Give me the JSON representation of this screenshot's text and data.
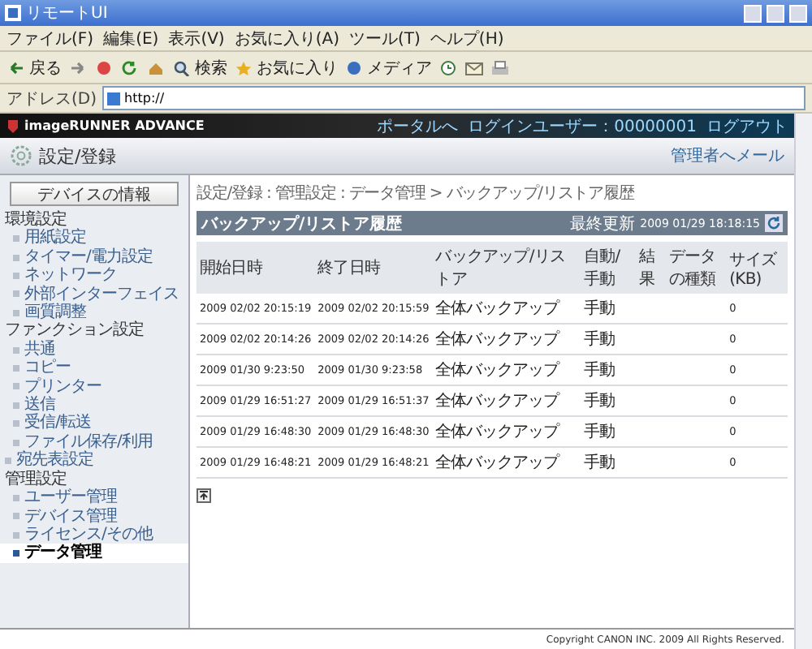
{
  "window": {
    "title": "リモートUI"
  },
  "menu_bar": [
    "ファイル(F)",
    "編集(E)",
    "表示(V)",
    "お気に入り(A)",
    "ツール(T)",
    "ヘルプ(H)"
  ],
  "toolbar": [
    {
      "label": "戻る",
      "kind": "back"
    },
    {
      "kind": "forward"
    },
    {
      "kind": "stop"
    },
    {
      "kind": "refresh"
    },
    {
      "kind": "home"
    },
    {
      "label": "検索",
      "kind": "search"
    },
    {
      "label": "お気に入り",
      "kind": "favorites"
    },
    {
      "label": "メディア",
      "kind": "media"
    },
    {
      "kind": "history"
    },
    {
      "kind": "mail"
    },
    {
      "kind": "print"
    }
  ],
  "address_bar": {
    "label": "アドレス(D)",
    "value": "http://"
  },
  "header": {
    "product": "imageRUNNER ADVANCE",
    "links": [
      "ポータルへ",
      "ログインユーザー：00000001",
      "ログアウト"
    ]
  },
  "section": {
    "title": "設定/登録",
    "mail_link": "管理者へメール"
  },
  "sidebar": {
    "button": "デバイスの情報",
    "tree": [
      {
        "label": "環境設定",
        "kind": "heading",
        "children": [
          {
            "label": "用紙設定",
            "selected": false
          },
          {
            "label": "タイマー/電力設定",
            "selected": false
          },
          {
            "label": "ネットワーク",
            "selected": false
          },
          {
            "label": "外部インターフェイス",
            "selected": false
          },
          {
            "label": "画質調整",
            "selected": false
          }
        ]
      },
      {
        "label": "ファンクション設定",
        "kind": "heading",
        "children": [
          {
            "label": "共通",
            "selected": false
          },
          {
            "label": "コピー",
            "selected": false
          },
          {
            "label": "プリンター",
            "selected": false
          },
          {
            "label": "送信",
            "selected": false
          },
          {
            "label": "受信/転送",
            "selected": false
          },
          {
            "label": "ファイル保存/利用",
            "selected": false
          }
        ]
      },
      {
        "label": "宛先表設定",
        "kind": "link",
        "selected": false
      },
      {
        "label": "管理設定",
        "kind": "heading",
        "children": [
          {
            "label": "ユーザー管理",
            "selected": false
          },
          {
            "label": "デバイス管理",
            "selected": false
          },
          {
            "label": "ライセンス/その他",
            "selected": false
          },
          {
            "label": "データ管理",
            "selected": true
          }
        ]
      }
    ]
  },
  "breadcrumb": "設定/登録 : 管理設定 : データ管理 > バックアップ/リストア履歴",
  "panel": {
    "title": "バックアップ/リストア履歴",
    "updated_label": "最終更新",
    "updated": "2009 01/29 18:18:15"
  },
  "table": {
    "columns": [
      "開始日時",
      "終了日時",
      "バックアップ/リストア",
      "自動/手動",
      "結果",
      "データの種類",
      "サイズ(KB)"
    ],
    "rows": [
      [
        "2009 02/02 20:15:19",
        "2009 02/02 20:15:59",
        "全体バックアップ",
        "手動",
        null,
        null,
        "0"
      ],
      [
        "2009 02/02 20:14:26",
        "2009 02/02 20:14:26",
        "全体バックアップ",
        "手動",
        null,
        null,
        "0"
      ],
      [
        "2009 01/30 9:23:50",
        "2009 01/30 9:23:58",
        "全体バックアップ",
        "手動",
        null,
        null,
        "0"
      ],
      [
        "2009 01/29 16:51:27",
        "2009 01/29 16:51:37",
        "全体バックアップ",
        "手動",
        null,
        null,
        "0"
      ],
      [
        "2009 01/29 16:48:30",
        "2009 01/29 16:48:30",
        "全体バックアップ",
        "手動",
        null,
        null,
        "0"
      ],
      [
        "2009 01/29 16:48:21",
        "2009 01/29 16:48:21",
        "全体バックアップ",
        "手動",
        null,
        null,
        "0"
      ]
    ]
  },
  "footer": "Copyright CANON INC. 2009 All Rights Reserved."
}
